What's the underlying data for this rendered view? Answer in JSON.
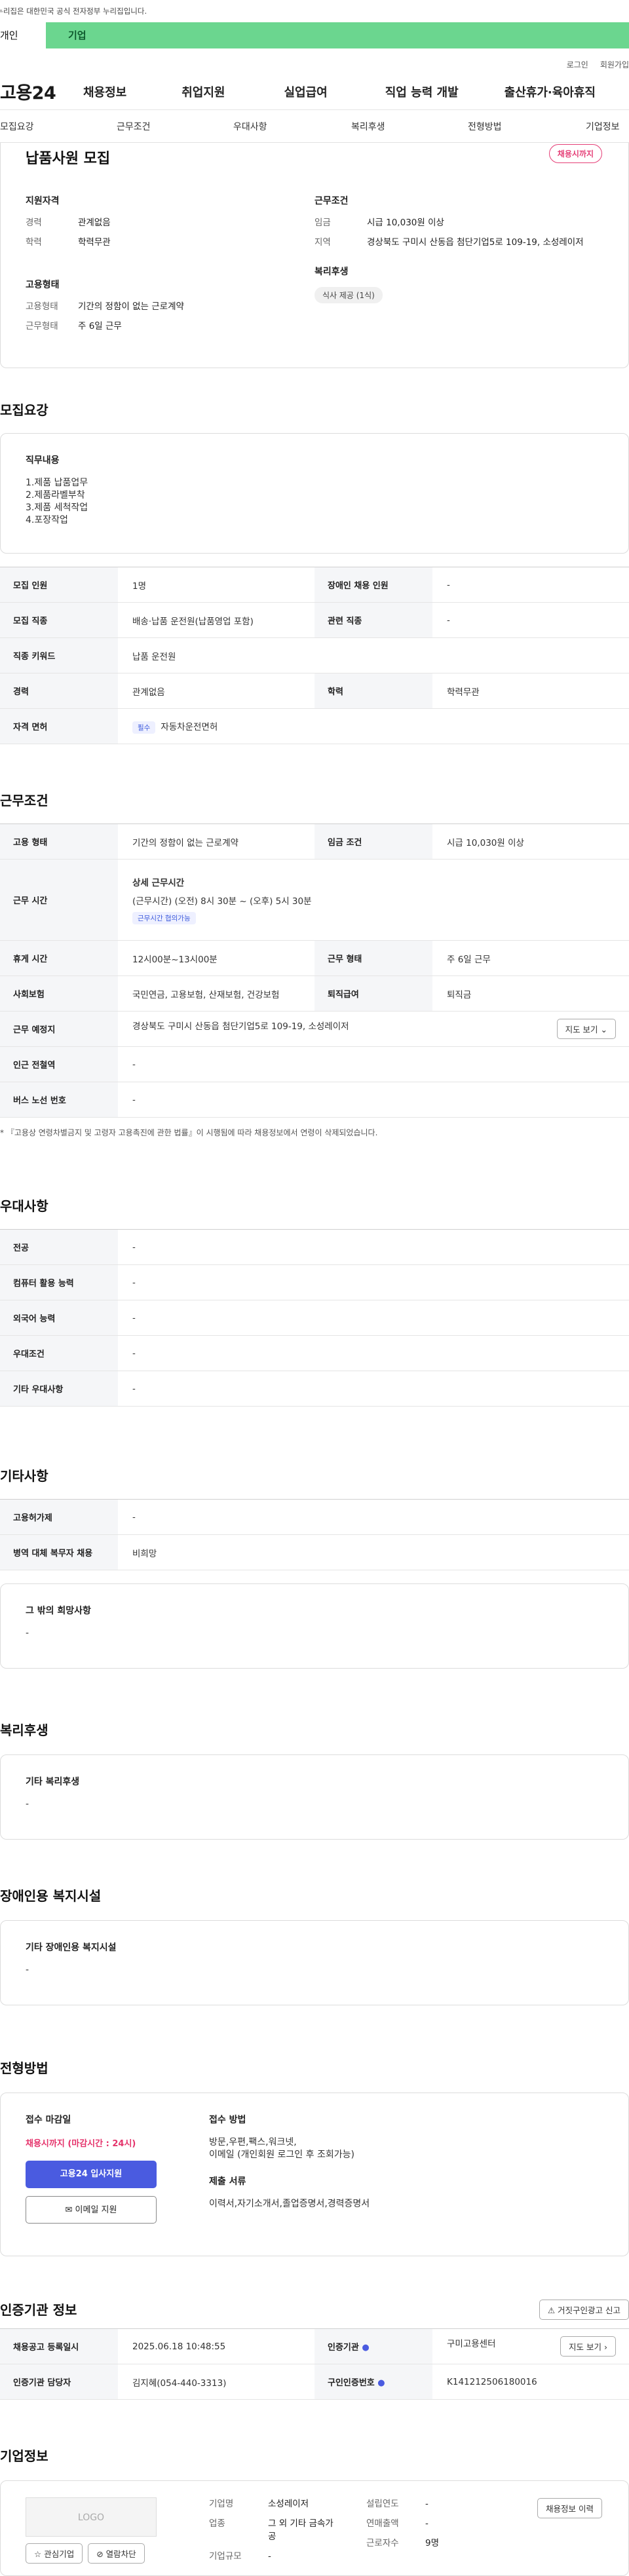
{
  "gov_banner": "이 누리집은 대한민국 공식 전자정부 누리집입니다.",
  "user_tabs": [
    "개인",
    "기업"
  ],
  "util": [
    "로그인",
    "회원가입"
  ],
  "logo": "고용24",
  "gnb": [
    "채용정보",
    "취업지원",
    "실업급여",
    "직업 능력 개발",
    "출산휴가·육아휴직"
  ],
  "subnav": [
    "모집요강",
    "근무조건",
    "우대사항",
    "복리후생",
    "전형방법",
    "기업정보"
  ],
  "title": "납품사원 모집",
  "badge": "채용시까지",
  "summary": {
    "qual_h": "지원자격",
    "career_k": "경력",
    "career_v": "관계없음",
    "edu_k": "학력",
    "edu_v": "학력무관",
    "emp_h": "고용형태",
    "emptype_k": "고용형태",
    "emptype_v": "기간의 정함이 없는 근로계약",
    "work_k": "근무형태",
    "work_v": "주 6일 근무",
    "cond_h": "근무조건",
    "wage_k": "임금",
    "wage_v": "시급 10,030원 이상",
    "area_k": "지역",
    "area_v": "경상북도 구미시 산동읍 첨단기업5로 109-19, 소성레이저",
    "welfare_h": "복리후생",
    "welfare_pill": "식사 제공 (1식)"
  },
  "recruit": {
    "h": "모집요강",
    "duty_h": "직무내용",
    "duties": [
      "1.제품 납품업무",
      "2.제품라벨부착",
      "3.제품 세척작업",
      "4.포장작업"
    ],
    "rows": [
      [
        "모집 인원",
        "1명",
        "장애인 채용 인원",
        "-"
      ],
      [
        "모집 직종",
        "배송·납품 운전원(납품영업 포함)",
        "관련 직종",
        "-"
      ],
      [
        "직종 키워드",
        "납품 운전원",
        "",
        ""
      ],
      [
        "경력",
        "관계없음",
        "학력",
        "학력무관"
      ]
    ],
    "license_k": "자격 면허",
    "license_tag": "필수",
    "license_v": "자동차운전면허"
  },
  "work": {
    "h": "근무조건",
    "type_k": "고용 형태",
    "type_v": "기간의 정함이 없는 근로계약",
    "wage_k": "임금 조건",
    "wage_v": "시급 10,030원 이상",
    "hours_k": "근무 시간",
    "hours_h": "상세 근무시간",
    "hours_v": "(근무시간) (오전) 8시 30분 ~ (오후) 5시 30분",
    "hours_tag": "근무시간 협의가능",
    "rest_k": "휴게 시간",
    "rest_v": "12시00분~13시00분",
    "form_k": "근무 형태",
    "form_v": "주 6일 근무",
    "ins_k": "사회보험",
    "ins_v": "국민연금, 고용보험, 산재보험, 건강보험",
    "sev_k": "퇴직급여",
    "sev_v": "퇴직금",
    "loc_k": "근무 예정지",
    "loc_v": "경상북도 구미시 산동읍 첨단기업5로 109-19, 소성레이저",
    "map": "지도 보기 ⌄",
    "subway_k": "인근 전철역",
    "subway_v": "-",
    "bus_k": "버스 노선 번호",
    "bus_v": "-",
    "note": "* 『고용상 연령차별금지 및 고령자 고용촉진에 관한 법률』이 시행됨에 따라 채용정보에서 연령이 삭제되었습니다."
  },
  "pref": {
    "h": "우대사항",
    "rows": [
      [
        "전공",
        "-"
      ],
      [
        "컴퓨터 활용 능력",
        "-"
      ],
      [
        "외국어 능력",
        "-"
      ],
      [
        "우대조건",
        "-"
      ],
      [
        "기타 우대사항",
        "-"
      ]
    ]
  },
  "etc": {
    "h": "기타사항",
    "rows": [
      [
        "고용허가제",
        "-"
      ],
      [
        "병역 대체 복무자 채용",
        "비희망"
      ]
    ],
    "other_h": "그 밖의 희망사항",
    "other_v": "-"
  },
  "welfare": {
    "h": "복리후생",
    "bh": "기타 복리후생",
    "bv": "-"
  },
  "disabled": {
    "h": "장애인용 복지시설",
    "bh": "기타 장애인용 복지시설",
    "bv": "-"
  },
  "process": {
    "h": "전형방법",
    "deadline_h": "접수 마감일",
    "deadline_v": "채용시까지 (마감시간 : 24시)",
    "apply": "고용24 입사지원",
    "email": "이메일 지원",
    "method_h": "접수 방법",
    "method_v1": "방문,우편,팩스,워크넷,",
    "method_v2": "이메일 (개인회원 로그인 후 조회가능)",
    "docs_h": "제출 서류",
    "docs_v": "이력서,자기소개서,졸업증명서,경력증명서"
  },
  "cert": {
    "h": "인증기관 정보",
    "report": "거짓구인광고 신고",
    "date_k": "채용공고 등록일시",
    "date_v": "2025.06.18 10:48:55",
    "org_k": "인증기관",
    "org_v": "구미고용센터",
    "map": "지도 보기 ›",
    "mgr_k": "인증기관 담당자",
    "mgr_v": "김지혜(054-440-3313)",
    "no_k": "구인인증번호",
    "no_v": "K141212506180016"
  },
  "company": {
    "h": "기업정보",
    "logo": "LOGO",
    "fav": "관심기업",
    "block": "열람차단",
    "name_k": "기업명",
    "name_v": "소성레이저",
    "ind_k": "업종",
    "ind_v": "그 외 기타 금속가공",
    "scale_k": "기업규모",
    "scale_v": "-",
    "year_k": "설립연도",
    "year_v": "-",
    "sales_k": "연매출액",
    "sales_v": "-",
    "emp_k": "근로자수",
    "emp_v": "9명",
    "history": "채용정보 이력"
  }
}
